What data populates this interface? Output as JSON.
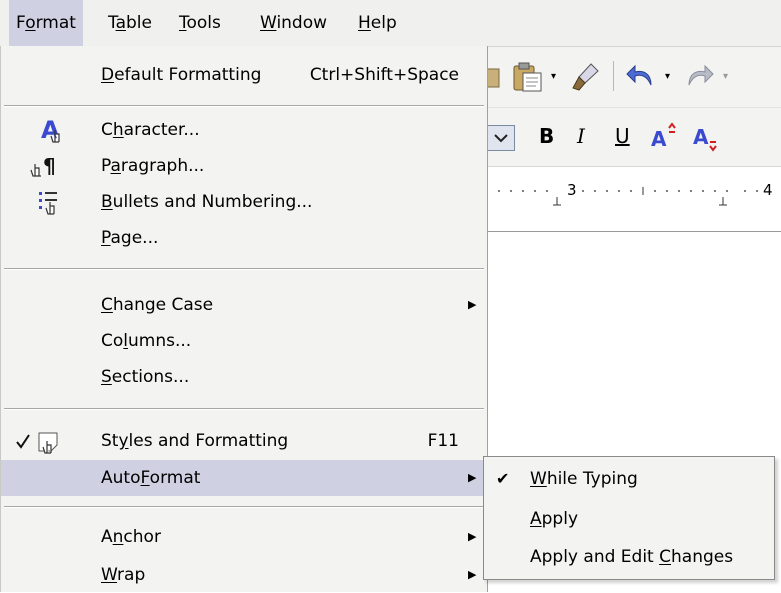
{
  "menubar": {
    "items": [
      {
        "pre": "F",
        "key": "o",
        "post": "rmat"
      },
      {
        "pre": "T",
        "key": "a",
        "post": "ble"
      },
      {
        "pre": "",
        "key": "T",
        "post": "ools"
      },
      {
        "pre": "",
        "key": "W",
        "post": "indow"
      },
      {
        "pre": "",
        "key": "H",
        "post": "elp"
      }
    ]
  },
  "format_menu": {
    "default_formatting": {
      "pre": "",
      "key": "D",
      "post": "efault Formatting",
      "accel": "Ctrl+Shift+Space"
    },
    "character": {
      "pre": "C",
      "key": "h",
      "post": "aracter..."
    },
    "paragraph": {
      "pre": "P",
      "key": "a",
      "post": "ragraph..."
    },
    "bullets": {
      "pre": "",
      "key": "B",
      "post": "ullets and Numbering..."
    },
    "page": {
      "pre": "",
      "key": "P",
      "post": "age..."
    },
    "change_case": {
      "pre": "",
      "key": "C",
      "post": "hange Case"
    },
    "columns": {
      "pre": "Co",
      "key": "l",
      "post": "umns..."
    },
    "sections": {
      "pre": "",
      "key": "S",
      "post": "ections..."
    },
    "styles": {
      "pre": "St",
      "key": "y",
      "post": "les and Formatting",
      "accel": "F11"
    },
    "autoformat": {
      "pre": "Auto",
      "key": "F",
      "post": "ormat"
    },
    "anchor": {
      "pre": "A",
      "key": "n",
      "post": "chor"
    },
    "wrap": {
      "pre": "",
      "key": "W",
      "post": "rap"
    }
  },
  "autoformat_submenu": {
    "while_typing": {
      "pre": "",
      "key": "W",
      "post": "hile Typing",
      "checked": true
    },
    "apply": {
      "pre": "",
      "key": "A",
      "post": "pply"
    },
    "apply_edit": {
      "pre": "Apply and Edit ",
      "key": "C",
      "post": "hanges"
    }
  },
  "toolbar": {
    "bold": "B",
    "italic": "I",
    "underline": "U",
    "ruler_3": "3",
    "ruler_4": "4"
  },
  "colors": {
    "menu_bg": "#f3f3f1",
    "highlight": "#cfd0e2",
    "icon_blue": "#3b4bd0"
  }
}
